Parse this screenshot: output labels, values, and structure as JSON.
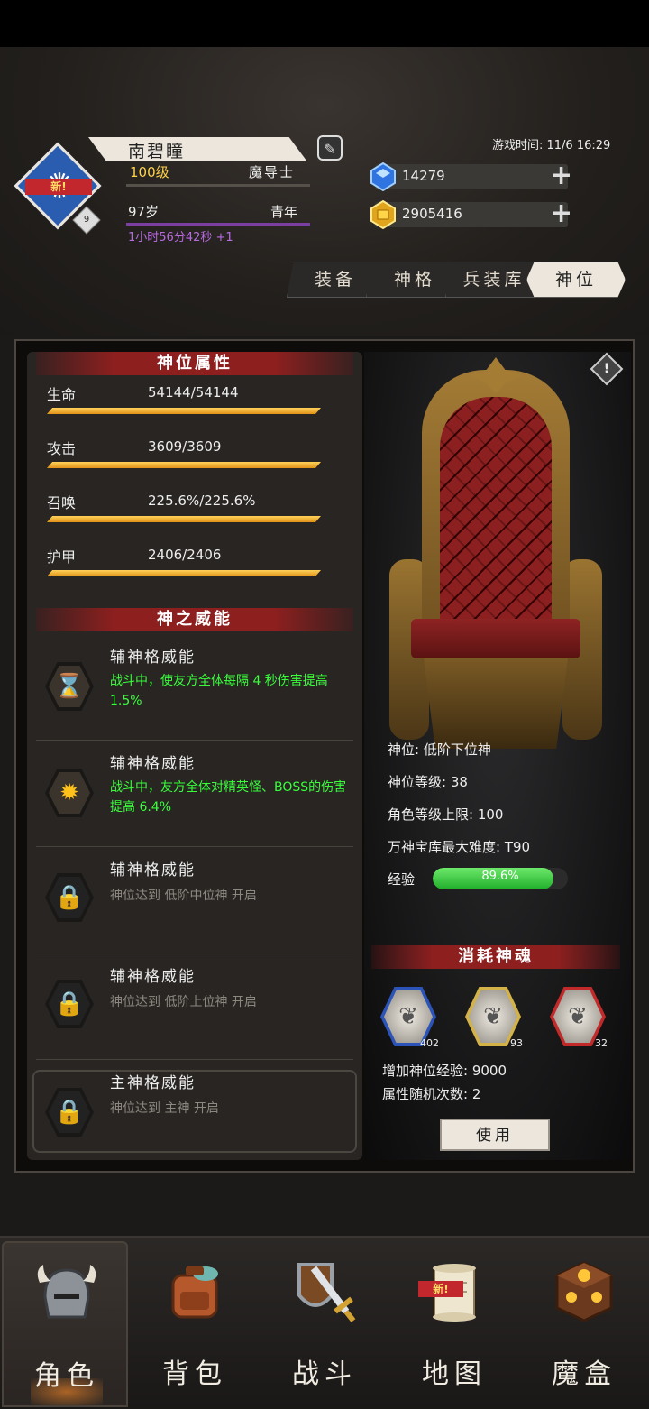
{
  "player": {
    "name": "南碧瞳",
    "level": "100级",
    "class": "魔导士",
    "age": "97岁",
    "stage": "青年",
    "timer": "1小时56分42秒 +1",
    "avatar_badge": "新!",
    "avatar_level": "9"
  },
  "game_time": "游戏时间: 11/6 16:29",
  "resources": [
    {
      "icon": "blue-gem-icon",
      "value": "14279"
    },
    {
      "icon": "gold-coin-icon",
      "value": "2905416"
    }
  ],
  "tabs": [
    "装备",
    "神格",
    "兵装库",
    "神位"
  ],
  "active_tab": "神位",
  "attributes_title": "神位属性",
  "attributes": [
    {
      "label": "生命",
      "value": "54144/54144",
      "fill": 1.0
    },
    {
      "label": "攻击",
      "value": "3609/3609",
      "fill": 1.0
    },
    {
      "label": "召唤",
      "value": "225.6%/225.6%",
      "fill": 1.0
    },
    {
      "label": "护甲",
      "value": "2406/2406",
      "fill": 1.0
    }
  ],
  "power_title": "神之威能",
  "skills": [
    {
      "title": "辅神格威能",
      "desc": "战斗中，使友方全体每隔 4 秒伤害提高 1.5%",
      "locked": false,
      "icon": "hourglass-icon"
    },
    {
      "title": "辅神格威能",
      "desc": "战斗中，友方全体对精英怪、BOSS的伤害提高 6.4%",
      "locked": false,
      "icon": "sun-icon"
    },
    {
      "title": "辅神格威能",
      "desc": "神位达到 低阶中位神 开启",
      "locked": true,
      "icon": "lock-icon"
    },
    {
      "title": "辅神格威能",
      "desc": "神位达到 低阶上位神 开启",
      "locked": true,
      "icon": "lock-icon"
    },
    {
      "title": "主神格威能",
      "desc": "神位达到 主神 开启",
      "locked": true,
      "icon": "lock-icon"
    }
  ],
  "throne_info": {
    "rank": "神位: 低阶下位神",
    "rank_level": "神位等级: 38",
    "char_level_cap": "角色等级上限: 100",
    "vault_max": "万神宝库最大难度: T90",
    "exp_label": "经验",
    "exp_text": "89.6%",
    "exp_fraction": 0.896
  },
  "consume_title": "消耗神魂",
  "souls": [
    {
      "count": "402",
      "color": "#2c53b8"
    },
    {
      "count": "93",
      "color": "#d4b24a"
    },
    {
      "count": "32",
      "color": "#c22a2a"
    }
  ],
  "gain_exp": "增加神位经验: 9000",
  "random_times": "属性随机次数: 2",
  "use_button": "使用",
  "nav": [
    {
      "label": "角色",
      "icon": "helmet-icon",
      "active": true
    },
    {
      "label": "背包",
      "icon": "backpack-icon",
      "active": false
    },
    {
      "label": "战斗",
      "icon": "sword-shield-icon",
      "active": false
    },
    {
      "label": "地图",
      "icon": "scroll-map-icon",
      "active": false,
      "badge": "新!"
    },
    {
      "label": "魔盒",
      "icon": "magic-box-icon",
      "active": false
    }
  ]
}
